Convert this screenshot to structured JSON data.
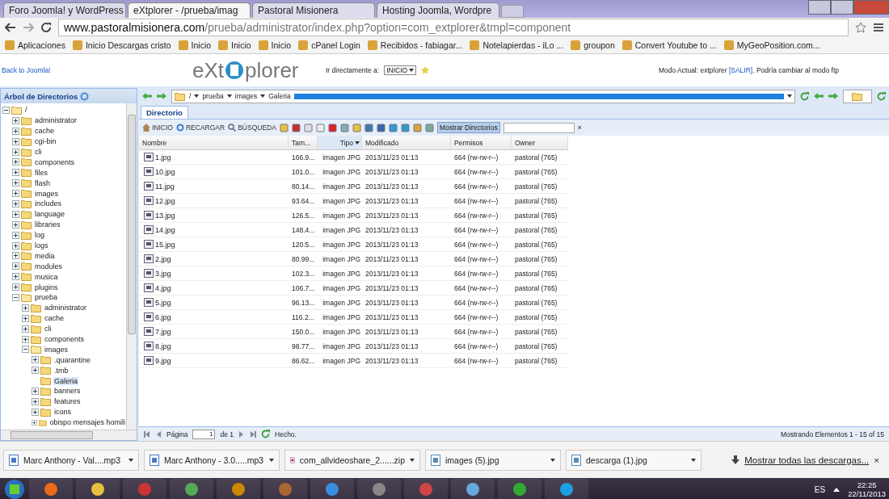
{
  "browser_tabs": [
    {
      "title": "Foro Joomla! y WordPress",
      "selected": false
    },
    {
      "title": "eXtplorer - /prueba/imag",
      "selected": true
    },
    {
      "title": "Pastoral Misionera",
      "selected": false
    },
    {
      "title": "Hosting Joomla, Wordpre",
      "selected": false
    }
  ],
  "address": {
    "host": "www.pastoralmisionera.com",
    "path": "/prueba/administrator/index.php?option=com_extplorer&tmpl=component"
  },
  "bookmarks": [
    "Aplicaciones",
    "Inicio Descargas cristo",
    "Inicio",
    "Inicio",
    "Inicio",
    "cPanel Login",
    "Recibidos - fabiagar...",
    "Notelapierdas - iLo ...",
    "groupon",
    "Convert Youtube to ...",
    "MyGeoPosition.com..."
  ],
  "header": {
    "back_link": "Back to Joomla!",
    "logo_left": "eXt",
    "logo_right": "plorer",
    "jump_label": "Ir directamente a:",
    "jump_value": "INICIO",
    "mode_text": "Modo Actual: extplorer",
    "mode_link": "[SALIR]",
    "mode_suffix": ". Podría cambiar al modo ftp"
  },
  "tree": {
    "title": "Árbol de Directorios",
    "nodes": [
      {
        "label": "/",
        "expanded": true,
        "selected": false,
        "children": [
          {
            "label": "administrator",
            "expanded": false,
            "selected": false
          },
          {
            "label": "cache",
            "expanded": false,
            "selected": false
          },
          {
            "label": "cgi-bin",
            "expanded": false,
            "selected": false
          },
          {
            "label": "cli",
            "expanded": false,
            "selected": false
          },
          {
            "label": "components",
            "expanded": false,
            "selected": false
          },
          {
            "label": "files",
            "expanded": false,
            "selected": false
          },
          {
            "label": "flash",
            "expanded": false,
            "selected": false
          },
          {
            "label": "images",
            "expanded": false,
            "selected": false
          },
          {
            "label": "includes",
            "expanded": false,
            "selected": false
          },
          {
            "label": "language",
            "expanded": false,
            "selected": false
          },
          {
            "label": "libraries",
            "expanded": false,
            "selected": false
          },
          {
            "label": "log",
            "expanded": false,
            "selected": false
          },
          {
            "label": "logs",
            "expanded": false,
            "selected": false
          },
          {
            "label": "media",
            "expanded": false,
            "selected": false
          },
          {
            "label": "modules",
            "expanded": false,
            "selected": false
          },
          {
            "label": "musica",
            "expanded": false,
            "selected": false
          },
          {
            "label": "plugins",
            "expanded": false,
            "selected": false
          },
          {
            "label": "prueba",
            "expanded": true,
            "selected": false,
            "children": [
              {
                "label": "administrator",
                "expanded": false,
                "selected": false
              },
              {
                "label": "cache",
                "expanded": false,
                "selected": false
              },
              {
                "label": "cli",
                "expanded": false,
                "selected": false
              },
              {
                "label": "components",
                "expanded": false,
                "selected": false
              },
              {
                "label": "images",
                "expanded": true,
                "selected": false,
                "children": [
                  {
                    "label": ".quarantine",
                    "expanded": false,
                    "selected": false
                  },
                  {
                    "label": ".tmb",
                    "expanded": false,
                    "selected": false
                  },
                  {
                    "label": "Galeria",
                    "selected": true
                  },
                  {
                    "label": "banners",
                    "expanded": false,
                    "selected": false
                  },
                  {
                    "label": "features",
                    "expanded": false,
                    "selected": false
                  },
                  {
                    "label": "icons",
                    "expanded": false,
                    "selected": false
                  },
                  {
                    "label": "obispo mensajes homili",
                    "expanded": false,
                    "selected": false
                  }
                ]
              }
            ]
          }
        ]
      }
    ]
  },
  "path": [
    "/",
    "prueba",
    "images",
    "Galeria"
  ],
  "panel_tabs": [
    {
      "label": "Directorio",
      "selected": true
    }
  ],
  "toolbar": {
    "home": "INICIO",
    "reload": "RECARGAR",
    "search": "BÚSQUEDA",
    "show_dirs": "Mostrar Directorios",
    "clear": "×"
  },
  "table": {
    "columns": [
      {
        "label": "Nombre",
        "sorted": false
      },
      {
        "label": "Tam...",
        "sorted": false
      },
      {
        "label": "Tipo",
        "sorted": true
      },
      {
        "label": "Modificado",
        "sorted": false
      },
      {
        "label": "Permisos",
        "sorted": false
      },
      {
        "label": "Owner",
        "sorted": false
      }
    ],
    "rows": [
      [
        "1.jpg",
        "166.9...",
        "imagen JPG",
        "2013/11/23 01:13",
        "664 (rw-rw-r--)",
        "pastoral (765)"
      ],
      [
        "10.jpg",
        "101.0...",
        "imagen JPG",
        "2013/11/23 01:13",
        "664 (rw-rw-r--)",
        "pastoral (765)"
      ],
      [
        "11.jpg",
        "80.14...",
        "imagen JPG",
        "2013/11/23 01:13",
        "664 (rw-rw-r--)",
        "pastoral (765)"
      ],
      [
        "12.jpg",
        "93.64...",
        "imagen JPG",
        "2013/11/23 01:13",
        "664 (rw-rw-r--)",
        "pastoral (765)"
      ],
      [
        "13.jpg",
        "126.5...",
        "imagen JPG",
        "2013/11/23 01:13",
        "664 (rw-rw-r--)",
        "pastoral (765)"
      ],
      [
        "14.jpg",
        "148.4...",
        "imagen JPG",
        "2013/11/23 01:13",
        "664 (rw-rw-r--)",
        "pastoral (765)"
      ],
      [
        "15.jpg",
        "120.5...",
        "imagen JPG",
        "2013/11/23 01:13",
        "664 (rw-rw-r--)",
        "pastoral (765)"
      ],
      [
        "2.jpg",
        "80.99...",
        "imagen JPG",
        "2013/11/23 01:13",
        "664 (rw-rw-r--)",
        "pastoral (765)"
      ],
      [
        "3.jpg",
        "102.3...",
        "imagen JPG",
        "2013/11/23 01:13",
        "664 (rw-rw-r--)",
        "pastoral (765)"
      ],
      [
        "4.jpg",
        "106.7...",
        "imagen JPG",
        "2013/11/23 01:13",
        "664 (rw-rw-r--)",
        "pastoral (765)"
      ],
      [
        "5.jpg",
        "96.13...",
        "imagen JPG",
        "2013/11/23 01:13",
        "664 (rw-rw-r--)",
        "pastoral (765)"
      ],
      [
        "6.jpg",
        "116.2...",
        "imagen JPG",
        "2013/11/23 01:13",
        "664 (rw-rw-r--)",
        "pastoral (765)"
      ],
      [
        "7.jpg",
        "150.0...",
        "imagen JPG",
        "2013/11/23 01:13",
        "664 (rw-rw-r--)",
        "pastoral (765)"
      ],
      [
        "8.jpg",
        "98.77...",
        "imagen JPG",
        "2013/11/23 01:13",
        "664 (rw-rw-r--)",
        "pastoral (765)"
      ],
      [
        "9.jpg",
        "86.62...",
        "imagen JPG",
        "2013/11/23 01:13",
        "664 (rw-rw-r--)",
        "pastoral (765)"
      ]
    ]
  },
  "paging": {
    "page_label": "Página",
    "page_value": "1",
    "page_total": "de 1",
    "status": "Hecho.",
    "summary": "Mostrando Elementos 1 - 15 of 15"
  },
  "downloads": {
    "items": [
      {
        "name": "Marc Anthony - Val....mp3",
        "kind": "audio"
      },
      {
        "name": "Marc Anthony - 3.0.....mp3",
        "kind": "audio"
      },
      {
        "name": "com_allvideoshare_2......zip",
        "kind": "archive"
      },
      {
        "name": "images (5).jpg",
        "kind": "image"
      },
      {
        "name": "descarga (1).jpg",
        "kind": "image"
      }
    ],
    "show_all": "Mostrar todas las descargas...",
    "close": "×"
  },
  "taskbar": {
    "language": "ES",
    "time": "22:25",
    "date": "22/11/2013"
  }
}
